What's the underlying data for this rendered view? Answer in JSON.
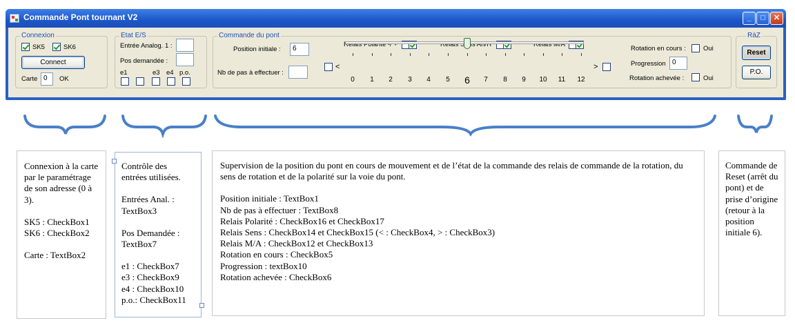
{
  "window": {
    "title": "Commande Pont tournant V2",
    "controls": [
      "minimize",
      "maximize",
      "close"
    ]
  },
  "connexion": {
    "group_title": "Connexion",
    "sk5_label": "SK5",
    "sk5_checked": true,
    "sk6_label": "SK6",
    "sk6_checked": true,
    "connect_label": "Connect",
    "carte_label": "Carte",
    "carte_value": "0",
    "status": "OK"
  },
  "etat": {
    "group_title": "Etat E/S",
    "analog_label": "Entrée Analog. 1 :",
    "analog_value": "",
    "pos_label": "Pos demandée :",
    "pos_value": "",
    "checks": [
      {
        "label": "e1",
        "checked": false
      },
      {
        "label": "e3",
        "checked": false
      },
      {
        "label": "e4",
        "checked": false
      },
      {
        "label": "p.o.",
        "checked": false
      }
    ]
  },
  "commande": {
    "group_title": "Commande du pont",
    "position_label": "Position initiale :",
    "position_value": "6",
    "nbpas_label": "Nb de pas à effectuer :",
    "nbpas_value": "",
    "polarite_label": "Relais Polarité -/ +",
    "sens_label": "Relais Sens Ah/H",
    "ma_label": "Relais M/A",
    "left_arrow": "<",
    "right_arrow": ">",
    "ticks": [
      "0",
      "1",
      "2",
      "3",
      "4",
      "5",
      "6",
      "7",
      "8",
      "9",
      "10",
      "11",
      "12"
    ],
    "slider_value": 6,
    "slider_min": 0,
    "slider_max": 12,
    "rotation_label": "Rotation en cours :",
    "rotation_oui": "Oui",
    "progression_label": "Progression",
    "progression_value": "0",
    "achevee_label": "Rotation achevée :",
    "achevee_oui": "Oui"
  },
  "raz": {
    "group_title": "RàZ",
    "reset_label": "Reset",
    "po_label": "P.O."
  },
  "descriptions": {
    "connexion": [
      "Connexion à la carte par le paramétrage de son adresse (0 à 3).",
      "",
      "SK5 : CheckBox1",
      "SK6 : CheckBox2",
      "",
      "Carte : TextBox2"
    ],
    "etat": [
      "Contrôle des entrées utilisées.",
      "",
      "Entrées Anal. : TextBox3",
      "",
      "Pos Demandée : TextBox7",
      "",
      "e1 : CheckBox7",
      "e3 : CheckBox9",
      "e4 : CheckBox10",
      "p.o.: CheckBox11"
    ],
    "commande": [
      "Supervision de la position du pont en cours de mouvement et de l’état de la commande des relais de commande de la rotation,  du sens de rotation et de la polarité sur la voie du pont.",
      "",
      "Position initiale : TextBox1",
      "Nb de pas à effectuer   : TextBox8",
      "Relais Polarité : CheckBox16 et CheckBox17",
      "Relais Sens : CheckBox14 et CheckBox15 (< : CheckBox4,  > : CheckBox3)",
      "Relais M/A : CheckBox12 et CheckBox13",
      "Rotation en cours : CheckBox5",
      "Progression : textBox10",
      "Rotation achevée : CheckBox6"
    ],
    "raz": [
      "Commande de Reset (arrêt du pont) et de prise d’origine (retour à la position initiale 6)."
    ]
  },
  "colors": {
    "titlebar": "#1d56c8",
    "client": "#ece9d8",
    "groupbox_title": "#1f4fb4",
    "brace": "#4a7fc9",
    "check": "#21a121"
  }
}
